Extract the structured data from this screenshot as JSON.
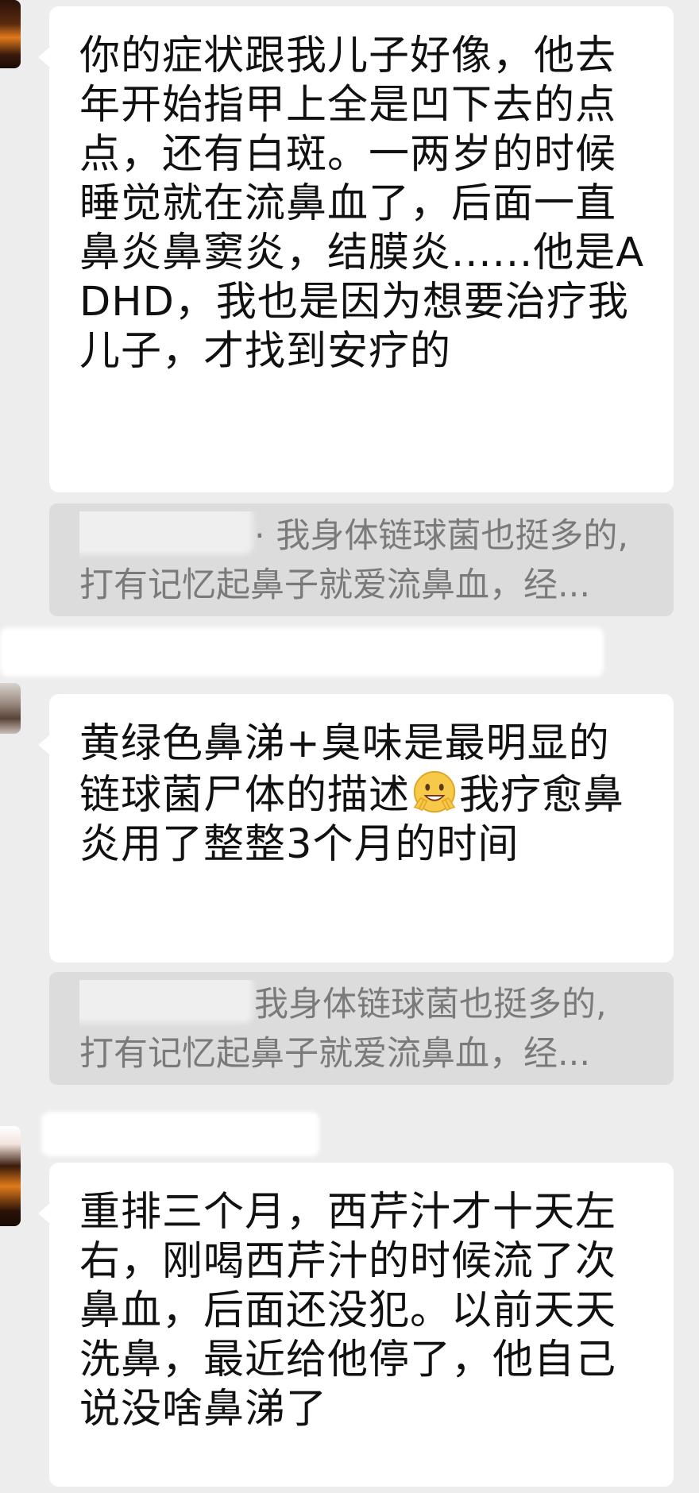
{
  "messages": [
    {
      "text": "你的症状跟我儿子好像，他去年开始指甲上全是凹下去的点点，还有白斑。一两岁的时候睡觉就在流鼻血了，后面一直鼻炎鼻窦炎，结膜炎......他是ADHD，我也是因为想要治疗我儿子，才找到安疗的"
    },
    {
      "text_before_emoji": "黄绿色鼻涕+臭味是最明显的链球菌尸体的描述",
      "emoji": "smiling-peace-emoji",
      "text_after_emoji": "我疗愈鼻炎用了整整3个月的时间"
    },
    {
      "text": "重排三个月，西芹汁才十天左右，刚喝西芹汁的时候流了次鼻血，后面还没犯。以前天天洗鼻，最近给他停了，他自己说没啥鼻涕了"
    }
  ],
  "quotes": [
    {
      "line1": "· 我身体链球菌也挺多的,",
      "line2": "打有记忆起鼻子就爱流鼻血，经..."
    },
    {
      "line1": "我身体链球菌也挺多的,",
      "line2": "打有记忆起鼻子就爱流鼻血，经..."
    }
  ],
  "colors": {
    "background": "#ededed",
    "bubble": "#ffffff",
    "quote_bg": "#dcdcdc",
    "quote_text": "#7a7a7a",
    "text": "#111111"
  }
}
